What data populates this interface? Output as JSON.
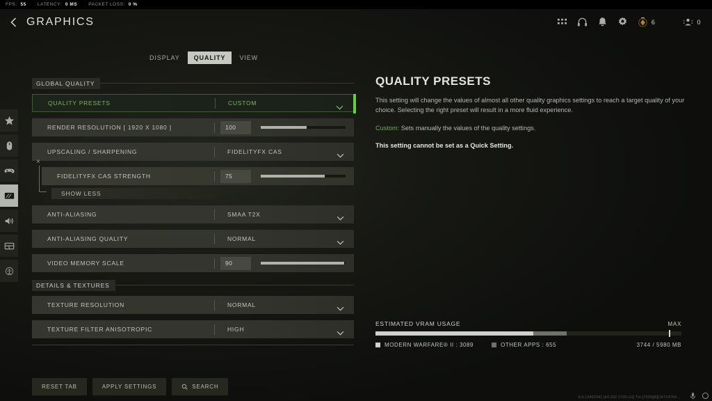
{
  "statusbar": {
    "fps_label": "FPS:",
    "fps_value": "55",
    "latency_label": "LATENCY:",
    "latency_value": "0 MS",
    "packet_label": "PACKET LOSS:",
    "packet_value": "0 %"
  },
  "header": {
    "title": "GRAPHICS",
    "back_icon": "chevron-left-icon",
    "icons": [
      "apps-grid-icon",
      "headset-icon",
      "bell-icon",
      "gear-icon"
    ],
    "currency_value": "6",
    "squad_value": "0"
  },
  "rail": {
    "items": [
      {
        "name": "favorites",
        "icon": "star-icon"
      },
      {
        "name": "mouse-keyboard",
        "icon": "mouse-icon"
      },
      {
        "name": "controller",
        "icon": "gamepad-icon"
      },
      {
        "name": "graphics",
        "icon": "monitor-icon"
      },
      {
        "name": "audio",
        "icon": "speaker-icon"
      },
      {
        "name": "interface",
        "icon": "layout-icon"
      },
      {
        "name": "accessibility",
        "icon": "accessibility-icon"
      }
    ],
    "selected_index": 3
  },
  "tabs": [
    {
      "label": "DISPLAY",
      "active": false
    },
    {
      "label": "QUALITY",
      "active": true
    },
    {
      "label": "VIEW",
      "active": false
    }
  ],
  "sections": {
    "global_quality": "GLOBAL QUALITY",
    "details_textures": "DETAILS & TEXTURES"
  },
  "rows": {
    "quality_presets": {
      "name": "QUALITY PRESETS",
      "value": "CUSTOM"
    },
    "render_resolution": {
      "name": "RENDER RESOLUTION [ 1920 X 1080 ]",
      "value": "100",
      "fill_pct": 54
    },
    "upscaling": {
      "name": "UPSCALING / SHARPENING",
      "value": "FIDELITYFX CAS"
    },
    "cas_strength": {
      "name": "FIDELITYFX CAS STRENGTH",
      "value": "75",
      "fill_pct": 75
    },
    "show_less": {
      "label": "SHOW LESS",
      "close_icon": "close-x-icon"
    },
    "anti_aliasing": {
      "name": "ANTI-ALIASING",
      "value": "SMAA T2X"
    },
    "aa_quality": {
      "name": "ANTI-ALIASING QUALITY",
      "value": "NORMAL"
    },
    "video_memory": {
      "name": "VIDEO MEMORY SCALE",
      "value": "90",
      "fill_pct": 98
    },
    "texture_resolution": {
      "name": "TEXTURE RESOLUTION",
      "value": "NORMAL"
    },
    "texture_filter": {
      "name": "TEXTURE FILTER ANISOTROPIC",
      "value": "HIGH"
    }
  },
  "buttons": {
    "reset": "RESET TAB",
    "apply": "APPLY SETTINGS",
    "search": "SEARCH",
    "search_icon": "search-icon"
  },
  "detail": {
    "title": "QUALITY PRESETS",
    "paragraph1": "This setting will change the values of almost all other quality graphics settings to reach a target quality of your choice. Selecting the right preset will result in a more fluid experience.",
    "custom_label": "Custom:",
    "custom_text": " Sets manually the values of the quality settings.",
    "paragraph3": "This setting cannot be set as a Quick Setting."
  },
  "vram": {
    "title": "ESTIMATED VRAM USAGE",
    "max_label": "MAX",
    "game_label": "MODERN WARFARE® II : 3089",
    "other_label": "OTHER APPS : 655",
    "total": "3744 / 5980 MB",
    "game_pct": 51.5,
    "other_pct": 11,
    "max_tick_pct": 96
  },
  "footer": {
    "build": "9.9.13492341 [44.202.1720+11] Tm [7000][8][16714764...",
    "mic_icon": "microphone-icon",
    "ping_icon": "ping-circle-icon"
  },
  "colors": {
    "accent_green": "#62d13a",
    "text_green": "#7fb45f"
  }
}
